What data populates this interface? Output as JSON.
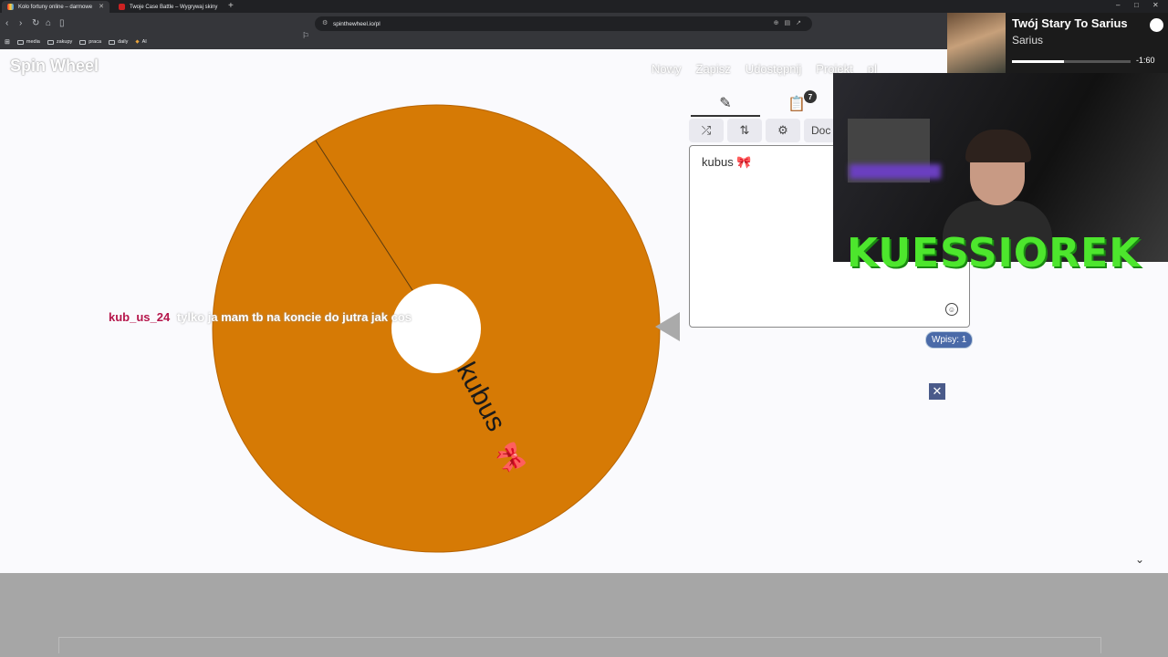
{
  "browser": {
    "tabs": [
      {
        "title": "Koło fortuny online – darmowe"
      },
      {
        "title": "Twoje Case Battle – Wygrywaj skiny"
      }
    ],
    "url": "spinthewheel.io/pl",
    "bookmarks": [
      "media",
      "zakupy",
      "praca",
      "daily",
      "AI"
    ]
  },
  "site": {
    "logo": "Spin Wheel",
    "nav": [
      "Nowy",
      "Zapisz",
      "Udostępnij",
      "Projekt",
      "pl"
    ]
  },
  "wheel": {
    "segment_label": "kubus",
    "segment_color": "#d67a05",
    "pointer_color": "#aaaaaa"
  },
  "chat": {
    "user": "kub_us_24",
    "message": "tylko ja mam tb na koncie do jutra jak cos"
  },
  "panel": {
    "badge": "7",
    "tools": [
      "shuffle-icon",
      "sort-icon",
      "gear-icon"
    ],
    "doc_label": "Doc",
    "entries": [
      "kubus 🎀"
    ],
    "count_label": "Wpisy: 1"
  },
  "music": {
    "title": "Twój Stary To Sarius",
    "artist": "Sarius",
    "time": "-1:60",
    "progress": 0.44
  },
  "overlay": {
    "name": "KUESSIOREK"
  }
}
